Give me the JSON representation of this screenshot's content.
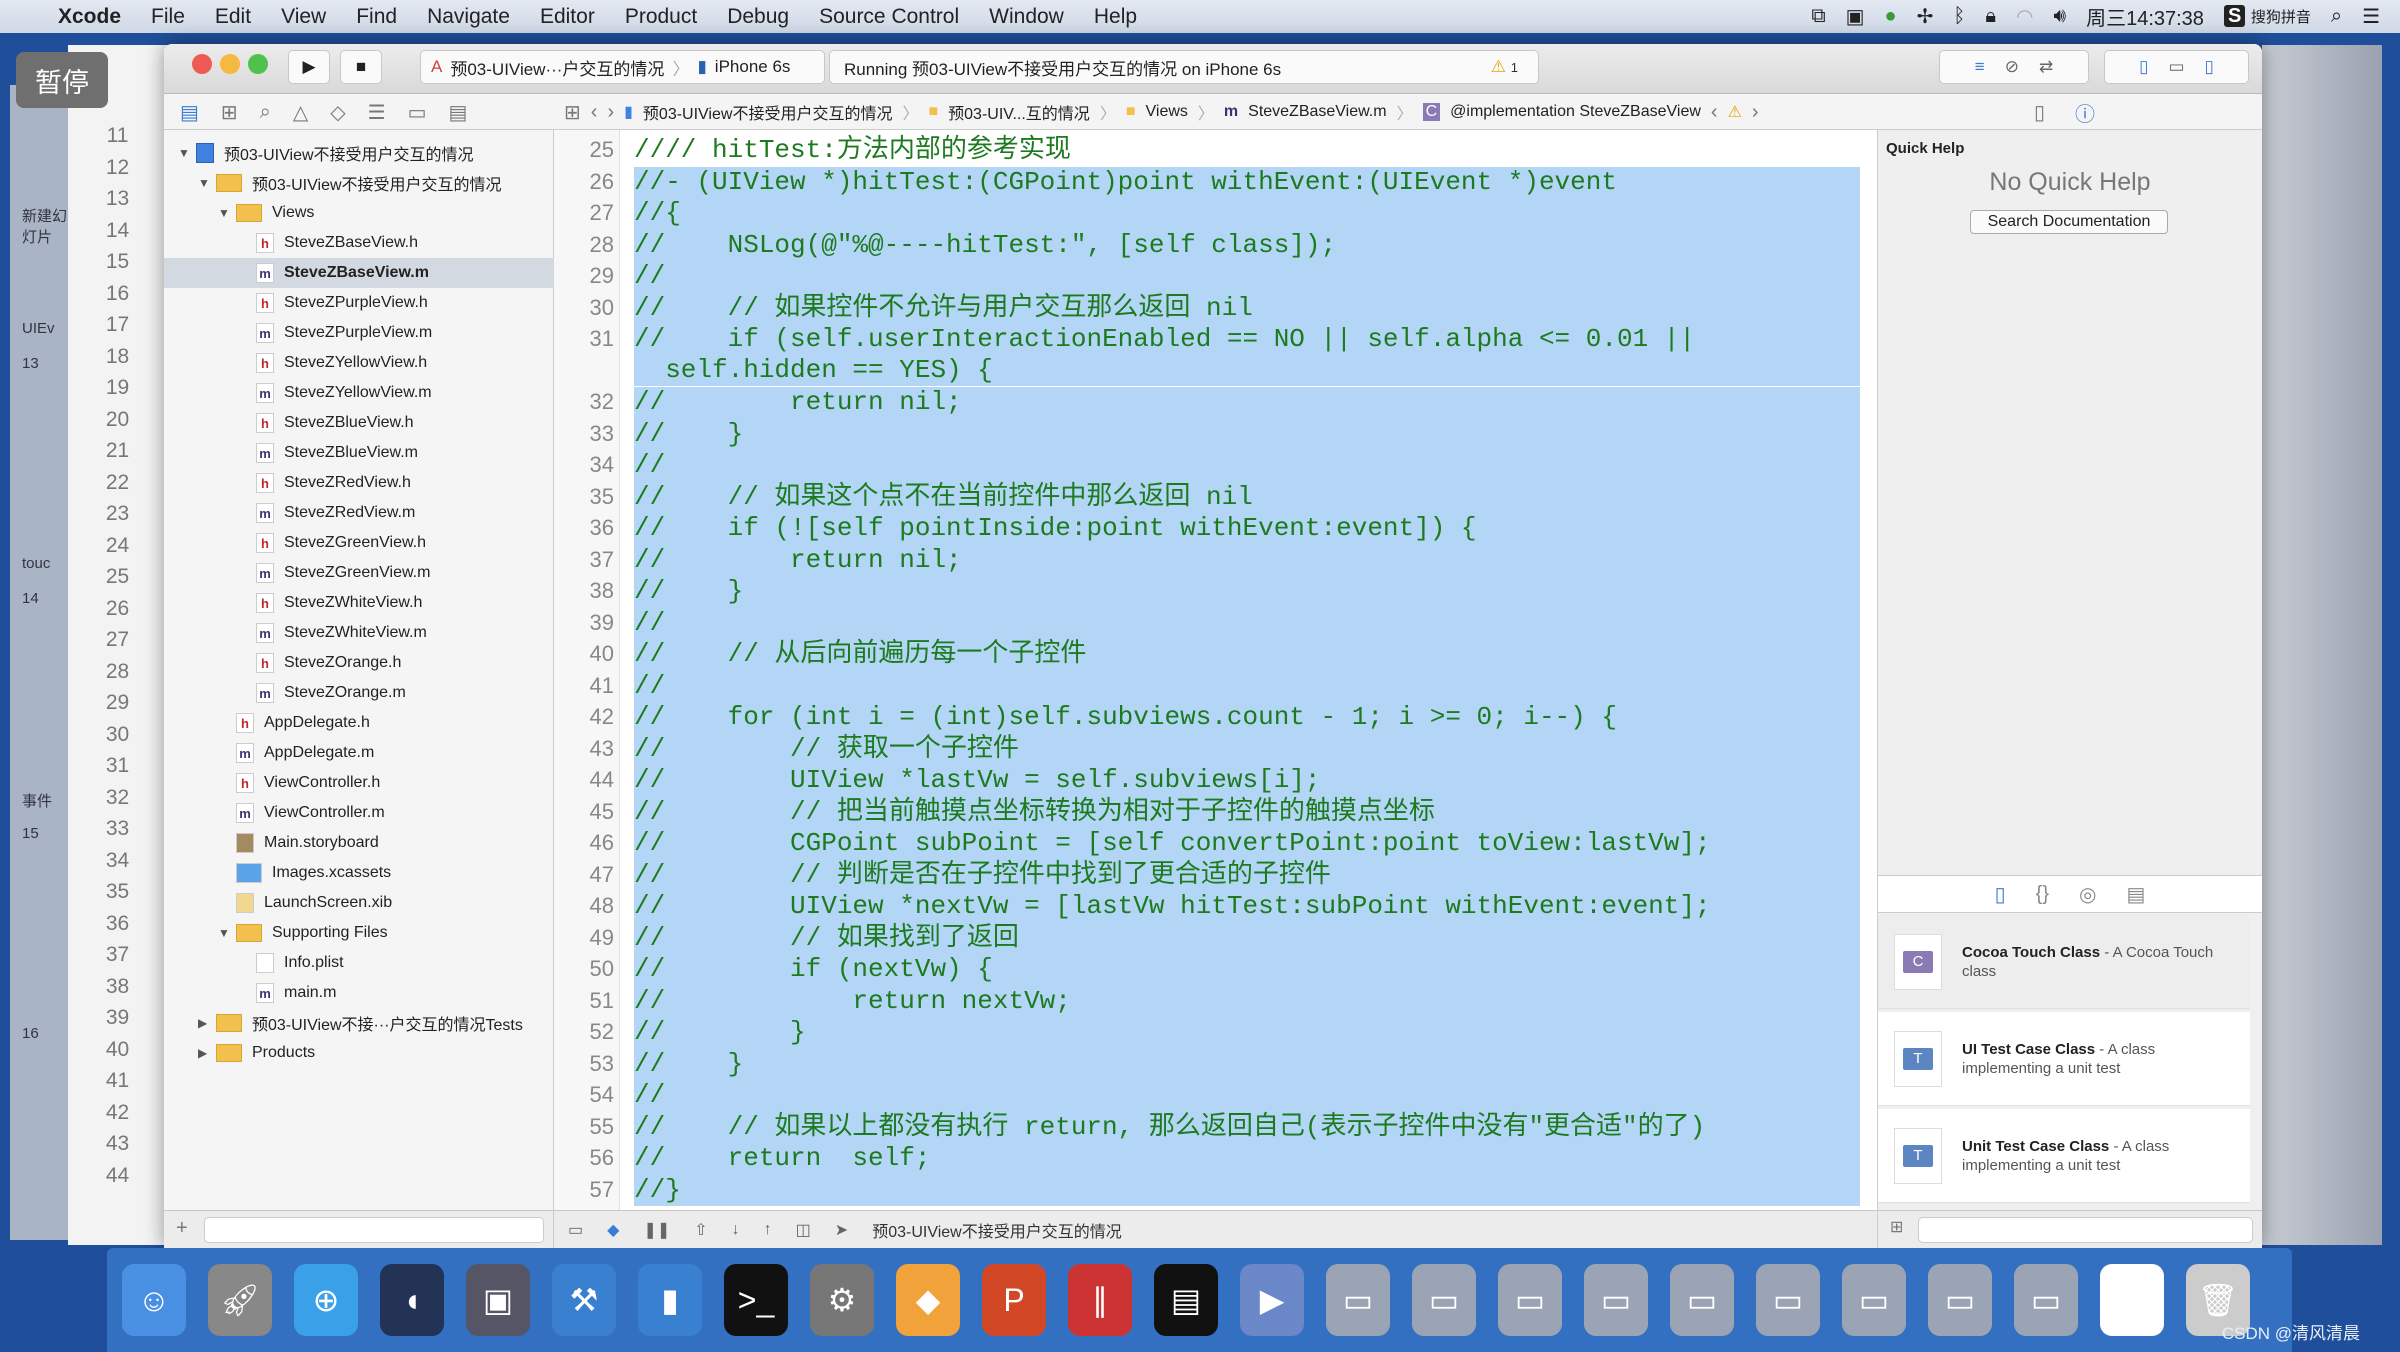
{
  "menubar": {
    "apple": "",
    "app": "Xcode",
    "items": [
      "File",
      "Edit",
      "View",
      "Find",
      "Navigate",
      "Editor",
      "Product",
      "Debug",
      "Source Control",
      "Window",
      "Help"
    ],
    "status": {
      "clock": "周三14:37:38",
      "ime": "搜狗拼音",
      "icons": [
        "screen-mirror-icon",
        "video-icon",
        "app-status-icon",
        "plus-icon",
        "bluetooth-icon",
        "lock-icon",
        "wifi-icon",
        "volume-icon",
        "search-icon",
        "list-icon"
      ]
    }
  },
  "overlay": {
    "pause": "暂停"
  },
  "background_window": {
    "sidebar": [
      "新建幻灯片",
      "UIEv",
      "13",
      "touc",
      "14",
      "事件",
      "15",
      "16"
    ],
    "line_numbers": [
      "11",
      "12",
      "13",
      "14",
      "15",
      "16",
      "17",
      "18",
      "19",
      "20",
      "21",
      "22",
      "23",
      "24",
      "25",
      "26",
      "27",
      "28",
      "29",
      "30",
      "31",
      "32",
      "33",
      "34",
      "35",
      "36",
      "37",
      "38",
      "39",
      "40",
      "41",
      "42",
      "43",
      "44"
    ]
  },
  "toolbar": {
    "scheme": "预03-UIView···户交互的情况",
    "device": "iPhone 6s",
    "activity": "Running 预03-UIView不接受用户交互的情况 on iPhone 6s",
    "warnings": "1"
  },
  "jumpbar": [
    "预03-UIView不接受用户交互的情况",
    "预03-UIV...互的情况",
    "Views",
    "SteveZBaseView.m",
    "@implementation SteveZBaseView"
  ],
  "navigator": {
    "items": [
      {
        "label": "预03-UIView不接受用户交互的情况",
        "icon": "proj",
        "depth": 0,
        "open": true
      },
      {
        "label": "预03-UIView不接受用户交互的情况",
        "icon": "folder",
        "depth": 1,
        "open": true
      },
      {
        "label": "Views",
        "icon": "folder",
        "depth": 2,
        "open": true
      },
      {
        "label": "SteveZBaseView.h",
        "icon": "h",
        "depth": 3
      },
      {
        "label": "SteveZBaseView.m",
        "icon": "m",
        "depth": 3,
        "selected": true
      },
      {
        "label": "SteveZPurpleView.h",
        "icon": "h",
        "depth": 3
      },
      {
        "label": "SteveZPurpleView.m",
        "icon": "m",
        "depth": 3
      },
      {
        "label": "SteveZYellowView.h",
        "icon": "h",
        "depth": 3
      },
      {
        "label": "SteveZYellowView.m",
        "icon": "m",
        "depth": 3
      },
      {
        "label": "SteveZBlueView.h",
        "icon": "h",
        "depth": 3
      },
      {
        "label": "SteveZBlueView.m",
        "icon": "m",
        "depth": 3
      },
      {
        "label": "SteveZRedView.h",
        "icon": "h",
        "depth": 3
      },
      {
        "label": "SteveZRedView.m",
        "icon": "m",
        "depth": 3
      },
      {
        "label": "SteveZGreenView.h",
        "icon": "h",
        "depth": 3
      },
      {
        "label": "SteveZGreenView.m",
        "icon": "m",
        "depth": 3
      },
      {
        "label": "SteveZWhiteView.h",
        "icon": "h",
        "depth": 3
      },
      {
        "label": "SteveZWhiteView.m",
        "icon": "m",
        "depth": 3
      },
      {
        "label": "SteveZOrange.h",
        "icon": "h",
        "depth": 3
      },
      {
        "label": "SteveZOrange.m",
        "icon": "m",
        "depth": 3
      },
      {
        "label": "AppDelegate.h",
        "icon": "h",
        "depth": 2
      },
      {
        "label": "AppDelegate.m",
        "icon": "m",
        "depth": 2
      },
      {
        "label": "ViewController.h",
        "icon": "h",
        "depth": 2
      },
      {
        "label": "ViewController.m",
        "icon": "m",
        "depth": 2
      },
      {
        "label": "Main.storyboard",
        "icon": "story",
        "depth": 2
      },
      {
        "label": "Images.xcassets",
        "icon": "xcassets",
        "depth": 2
      },
      {
        "label": "LaunchScreen.xib",
        "icon": "xib",
        "depth": 2
      },
      {
        "label": "Supporting Files",
        "icon": "folder",
        "depth": 2,
        "open": true
      },
      {
        "label": "Info.plist",
        "icon": "plist",
        "depth": 3
      },
      {
        "label": "main.m",
        "icon": "m",
        "depth": 3
      },
      {
        "label": "预03-UIView不接···户交互的情况Tests",
        "icon": "folder",
        "depth": 1,
        "open": false
      },
      {
        "label": "Products",
        "icon": "folder",
        "depth": 1,
        "open": false
      }
    ]
  },
  "editor": {
    "selection_color": "#b4d6f6",
    "comment_color": "#1d7a1f",
    "lines": [
      {
        "n": "25",
        "t": "//// hitTest:方法内部的参考实现"
      },
      {
        "n": "26",
        "t": "//- (UIView *)hitTest:(CGPoint)point withEvent:(UIEvent *)event"
      },
      {
        "n": "27",
        "t": "//{"
      },
      {
        "n": "28",
        "t": "//    NSLog(@\"%@----hitTest:\", [self class]);"
      },
      {
        "n": "29",
        "t": "//"
      },
      {
        "n": "30",
        "t": "//    // 如果控件不允许与用户交互那么返回 nil"
      },
      {
        "n": "31",
        "t": "//    if (self.userInteractionEnabled == NO || self.alpha <= 0.01 ||"
      },
      {
        "n": "",
        "t": "  self.hidden == YES) {"
      },
      {
        "n": "32",
        "t": "//        return nil;"
      },
      {
        "n": "33",
        "t": "//    }"
      },
      {
        "n": "34",
        "t": "//"
      },
      {
        "n": "35",
        "t": "//    // 如果这个点不在当前控件中那么返回 nil"
      },
      {
        "n": "36",
        "t": "//    if (![self pointInside:point withEvent:event]) {"
      },
      {
        "n": "37",
        "t": "//        return nil;"
      },
      {
        "n": "38",
        "t": "//    }"
      },
      {
        "n": "39",
        "t": "//"
      },
      {
        "n": "40",
        "t": "//    // 从后向前遍历每一个子控件"
      },
      {
        "n": "41",
        "t": "//"
      },
      {
        "n": "42",
        "t": "//    for (int i = (int)self.subviews.count - 1; i >= 0; i--) {"
      },
      {
        "n": "43",
        "t": "//        // 获取一个子控件"
      },
      {
        "n": "44",
        "t": "//        UIView *lastVw = self.subviews[i];"
      },
      {
        "n": "45",
        "t": "//        // 把当前触摸点坐标转换为相对于子控件的触摸点坐标"
      },
      {
        "n": "46",
        "t": "//        CGPoint subPoint = [self convertPoint:point toView:lastVw];"
      },
      {
        "n": "47",
        "t": "//        // 判断是否在子控件中找到了更合适的子控件"
      },
      {
        "n": "48",
        "t": "//        UIView *nextVw = [lastVw hitTest:subPoint withEvent:event];"
      },
      {
        "n": "49",
        "t": "//        // 如果找到了返回"
      },
      {
        "n": "50",
        "t": "//        if (nextVw) {"
      },
      {
        "n": "51",
        "t": "//            return nextVw;"
      },
      {
        "n": "52",
        "t": "//        }"
      },
      {
        "n": "53",
        "t": "//    }"
      },
      {
        "n": "54",
        "t": "//"
      },
      {
        "n": "55",
        "t": "//    // 如果以上都没有执行 return, 那么返回自己(表示子控件中没有\"更合适\"的了)"
      },
      {
        "n": "56",
        "t": "//    return  self;"
      },
      {
        "n": "57",
        "t": "//}"
      }
    ]
  },
  "debugbar": {
    "target": "预03-UIView不接受用户交互的情况"
  },
  "inspector": {
    "title": "Quick Help",
    "empty": "No Quick Help",
    "search_button": "Search Documentation",
    "library": [
      {
        "icon": "C",
        "color": "#8a7bb5",
        "name": "Cocoa Touch Class",
        "desc": " - A Cocoa Touch class"
      },
      {
        "icon": "T",
        "color": "#5b86c2",
        "name": "UI Test Case Class",
        "desc": " - A class implementing a unit test"
      },
      {
        "icon": "T",
        "color": "#5b86c2",
        "name": "Unit Test Case Class",
        "desc": " - A class implementing a unit test"
      }
    ]
  },
  "dock": [
    "finder",
    "launchpad",
    "safari",
    "mouse-app",
    "photo-slideshow",
    "xcode",
    "simulator",
    "terminal",
    "system-preferences",
    "sketch",
    "powerpoint",
    "parallels",
    "console",
    "quicktime",
    "screenshot-1",
    "screenshot-2",
    "screenshot-3",
    "screenshot-4",
    "screenshot-5",
    "screenshot-6",
    "screenshot-7",
    "screenshot-8",
    "screenshot-9",
    "document",
    "trash"
  ],
  "watermark": "CSDN @清风清晨"
}
